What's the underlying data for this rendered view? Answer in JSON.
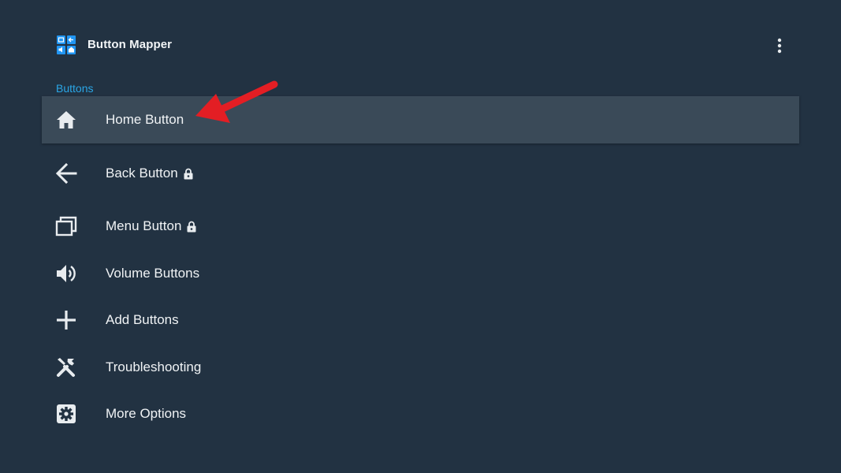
{
  "app": {
    "title": "Button Mapper",
    "logo_icon": "button-mapper-logo-icon",
    "overflow_icon": "more-vert-icon"
  },
  "colors": {
    "background": "#223242",
    "selected_row": "#3a4a58",
    "section_header": "#2aa6e6",
    "annotation_arrow": "#e31e24"
  },
  "section": {
    "title": "Buttons"
  },
  "menu": {
    "items": [
      {
        "label": "Home Button",
        "icon": "home-icon",
        "locked": false,
        "selected": true
      },
      {
        "label": "Back Button",
        "icon": "back-arrow-icon",
        "locked": true,
        "selected": false
      },
      {
        "label": "Menu Button",
        "icon": "recent-apps-icon",
        "locked": true,
        "selected": false
      },
      {
        "label": "Volume Buttons",
        "icon": "volume-icon",
        "locked": false,
        "selected": false
      },
      {
        "label": "Add Buttons",
        "icon": "plus-icon",
        "locked": false,
        "selected": false
      },
      {
        "label": "Troubleshooting",
        "icon": "tools-icon",
        "locked": false,
        "selected": false
      },
      {
        "label": "More Options",
        "icon": "settings-gear-icon",
        "locked": false,
        "selected": false
      }
    ]
  }
}
